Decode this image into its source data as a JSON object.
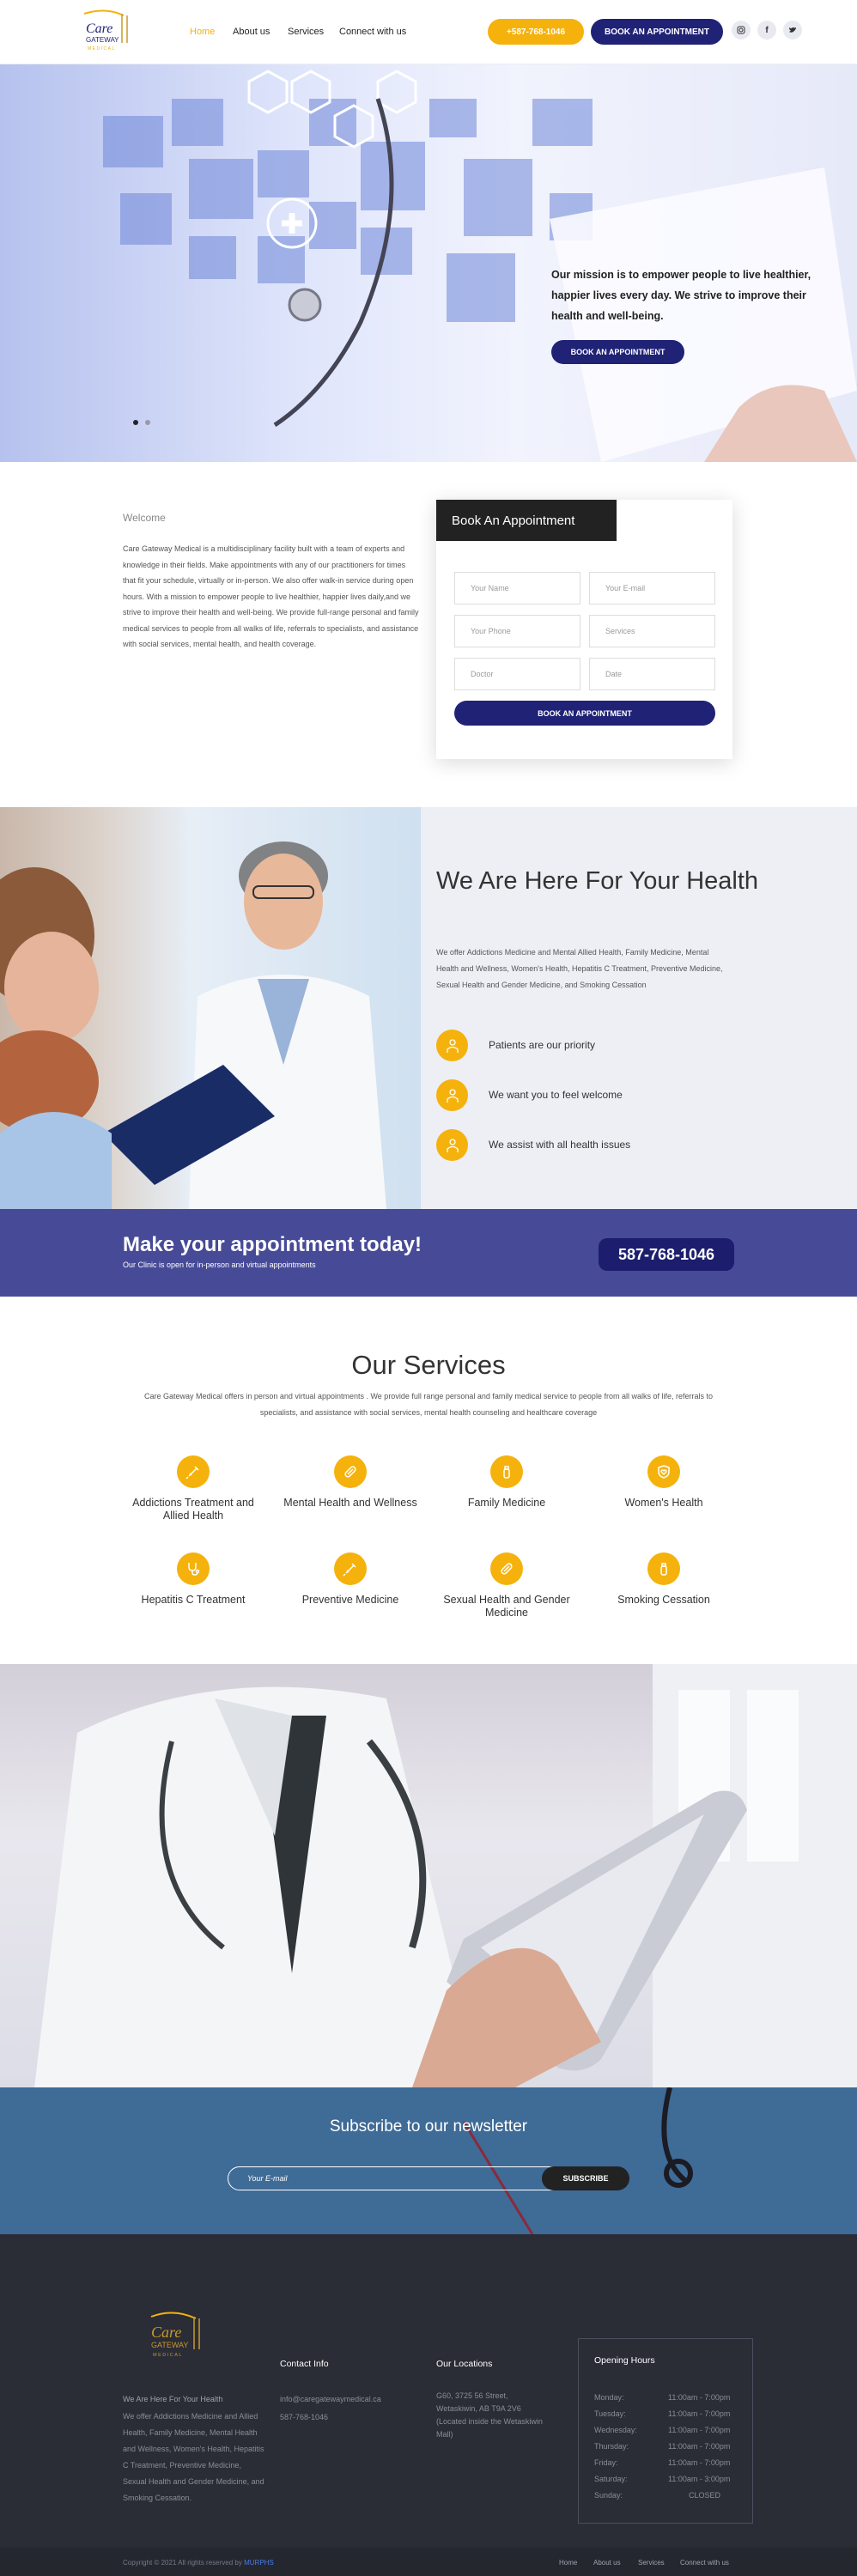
{
  "header": {
    "logo_lines": [
      "Care",
      "GATEWAY",
      "MEDICAL"
    ],
    "nav": [
      "Home",
      "About us",
      "Services",
      "Connect with us"
    ],
    "phone_btn": "+587-768-1046",
    "book_btn": "BOOK AN APPOINTMENT",
    "social": [
      "instagram-icon",
      "facebook-icon",
      "twitter-icon"
    ]
  },
  "hero": {
    "text": "Our mission is to empower people to live healthier, happier lives every day. We strive to improve their health and well-being.",
    "button": "BOOK AN APPOINTMENT"
  },
  "welcome": {
    "label": "Welcome",
    "body": "Care Gateway Medical is a multidisciplinary facility built with a team of experts and knowledge in their fields. Make appointments with any of our practitioners for times that fit your schedule, virtually or in-person. We also offer walk-in service during open hours. With a mission to empower people to live healthier, happier lives daily,and we strive to improve their health and well-being. We provide full-range personal and family medical services to people from all walks of life, referrals to specialists, and assistance with social services, mental health, and health coverage."
  },
  "appointment": {
    "title": "Book An Appointment",
    "placeholders": [
      "Your Name",
      "Your E-mail",
      "Your Phone",
      "Services",
      "Doctor",
      "Date"
    ],
    "button": "BOOK AN APPOINTMENT"
  },
  "here": {
    "title": "We Are Here For Your Health",
    "body": "We offer Addictions Medicine and Mental Allied Health, Family Medicine, Mental Health and Wellness, Women's Health, Hepatitis C Treatment, Preventive Medicine, Sexual Health and Gender Medicine, and Smoking Cessation",
    "items": [
      "Patients are our priority",
      "We want you to feel welcome",
      "We assist with all health issues"
    ]
  },
  "banner": {
    "title": "Make your appointment today!",
    "subtitle": "Our Clinic is open for in-person and virtual appointments",
    "phone": "587-768-1046"
  },
  "services": {
    "title": "Our Services",
    "body": "Care Gateway Medical offers in person and virtual appointments . We provide full range personal and family medical service to people from all walks of life, referrals to specialists, and assistance with social services, mental health counseling and healthcare coverage",
    "items": [
      {
        "label": "Addictions Treatment and Allied Health",
        "icon": "syringe-icon"
      },
      {
        "label": "Mental Health and Wellness",
        "icon": "pill-icon"
      },
      {
        "label": "Family Medicine",
        "icon": "bottle-icon"
      },
      {
        "label": "Women's Health",
        "icon": "heart-shield-icon"
      },
      {
        "label": "Hepatitis C Treatment",
        "icon": "stethoscope-icon"
      },
      {
        "label": "Preventive Medicine",
        "icon": "syringe-icon"
      },
      {
        "label": "Sexual Health and Gender Medicine",
        "icon": "pill-icon"
      },
      {
        "label": "Smoking Cessation",
        "icon": "bottle-icon"
      }
    ]
  },
  "newsletter": {
    "title": "Subscribe to our newsletter",
    "placeholder": "Your E-mail",
    "button": "SUBSCRIBE"
  },
  "footer": {
    "about_title": "We Are Here For Your Health",
    "about_body": "We offer Addictions Medicine and Allied Health, Family Medicine, Mental Health and Wellness, Women's Health, Hepatitis C Treatment, Preventive Medicine, Sexual Health and Gender Medicine, and Smoking Cessation.",
    "contact_title": "Contact Info",
    "email": "info@caregatewaymedical.ca",
    "phone": "587-768-1046",
    "loc_title": "Our Locations",
    "address": "G60, 3725 56 Street, Wetaskiwin, AB T9A 2V6 (Located inside the Wetaskiwin Mall)",
    "hours_title": "Opening Hours",
    "hours": [
      {
        "day": "Monday:",
        "time": "11:00am - 7:00pm"
      },
      {
        "day": "Tuesday:",
        "time": "11:00am - 7:00pm"
      },
      {
        "day": "Wednesday:",
        "time": "11:00am - 7:00pm"
      },
      {
        "day": "Thursday:",
        "time": "11:00am - 7:00pm"
      },
      {
        "day": "Friday:",
        "time": "11:00am - 7:00pm"
      },
      {
        "day": "Saturday:",
        "time": "11:00am - 3:00pm"
      },
      {
        "day": "Sunday:",
        "time": "CLOSED"
      }
    ],
    "copyright": "Copyright © 2021 All rights reserved by",
    "copyright_brand": "MURPHS",
    "links": [
      "Home",
      "About us",
      "Services",
      "Connect with us"
    ]
  },
  "colors": {
    "accent": "#f5b20c",
    "navy": "#1f2275",
    "banner": "#474b97",
    "newsletter": "#3f6b97",
    "footer": "#2a2c36"
  }
}
